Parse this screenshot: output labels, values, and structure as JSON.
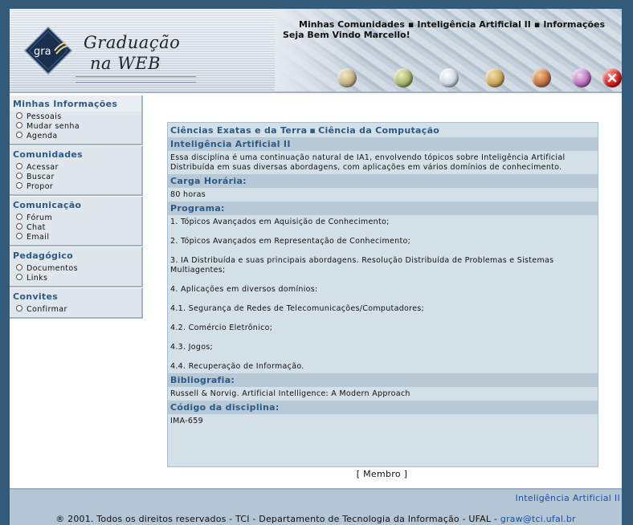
{
  "header": {
    "logo_prefix": "gra",
    "logo_line1": "Graduação",
    "logo_line2": "na WEB",
    "nav": [
      "Minhas Comunidades",
      "Inteligência Artificial II",
      "Informações"
    ],
    "welcome": "Seja Bem Vindo Marcello!",
    "toolbar_icons": [
      "people-icon",
      "tools-icon",
      "book-icon",
      "documents-icon",
      "user-icon",
      "notebook-icon",
      "close-icon"
    ]
  },
  "sidebar": {
    "sections": [
      {
        "title": "Minhas Informações",
        "items": [
          "Pessoais",
          "Mudar senha",
          "Agenda"
        ]
      },
      {
        "title": "Comunidades",
        "items": [
          "Acessar",
          "Buscar",
          "Propor"
        ]
      },
      {
        "title": "Comunicação",
        "items": [
          "Fórum",
          "Chat",
          "Email"
        ]
      },
      {
        "title": "Pedagógico",
        "items": [
          "Documentos",
          "Links"
        ]
      },
      {
        "title": "Convites",
        "items": [
          "Confirmar"
        ]
      }
    ]
  },
  "content": {
    "breadcrumb": [
      "Ciências Exatas e da Terra",
      "Ciência da Computação"
    ],
    "course_title": "Inteligência Artificial II",
    "description": "Essa disciplina é uma continuação natural de IA1, envolvendo tópicos sobre Inteligência Artificial Distribuída em suas diversas abordagens, com aplicações em vários domínios de conhecimento.",
    "workload_label": "Carga Horária:",
    "workload_value": "80 horas",
    "program_label": "Programa:",
    "program_items": [
      "1. Tópicos Avançados em Aquisição de Conhecimento;",
      "2. Tópicos Avançados em Representação de Conhecimento;",
      "3. IA Distribuída e suas principais abordagens. Resolução Distribuída de Problemas e Sistemas Multiagentes;",
      "4. Aplicações em diversos domínios:",
      "4.1. Segurança de Redes de Telecomunicações/Computadores;",
      "4.2. Comércio Eletrônico;",
      "4.3. Jogos;",
      "4.4. Recuperação de Informação."
    ],
    "bibliography_label": "Bibliografia:",
    "bibliography_value": "Russell & Norvig. Artificial Intelligence: A Modern Approach",
    "code_label": "Código da disciplina:",
    "code_value": "IMA-659"
  },
  "membro": "[ Membro ]",
  "footer": {
    "course": "Inteligência Artificial II",
    "copyright": "® 2001. Todos os direitos reservados - TCI - Departamento de Tecnologia da Informação - UFAL - ",
    "email": "graw@tci.ufal.br"
  },
  "colors": {
    "page_bg": "#345a7a",
    "heading": "#2b5a86",
    "panel_bg": "#d4e0e8",
    "header_row": "#b7c9d7",
    "link": "#1f4fa8"
  }
}
